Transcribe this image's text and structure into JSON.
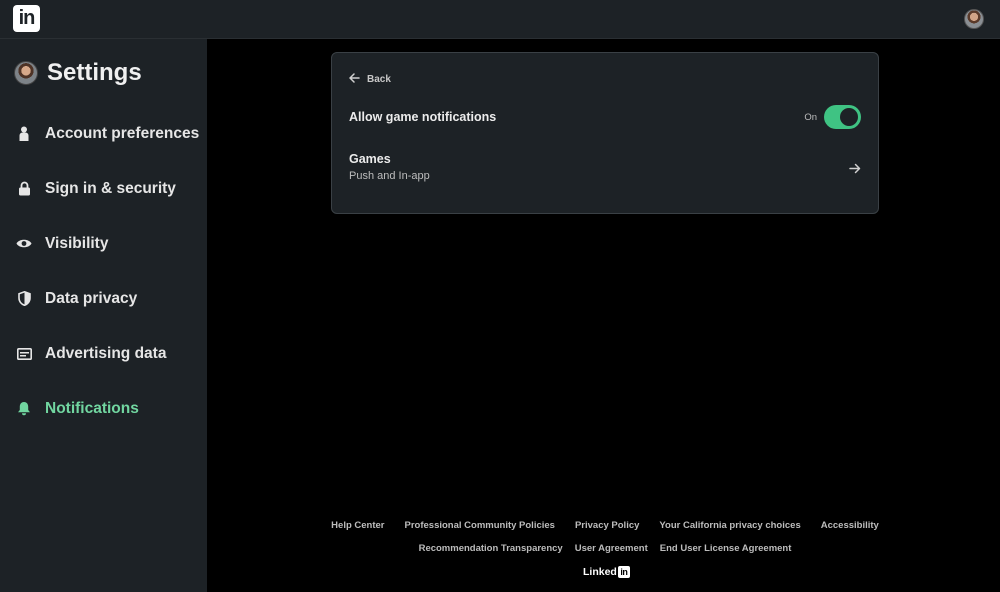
{
  "topbar": {
    "logo_text": "in"
  },
  "sidebar": {
    "title": "Settings",
    "items": [
      {
        "label": "Account preferences",
        "icon": "person-icon",
        "active": false
      },
      {
        "label": "Sign in & security",
        "icon": "lock-icon",
        "active": false
      },
      {
        "label": "Visibility",
        "icon": "eye-icon",
        "active": false
      },
      {
        "label": "Data privacy",
        "icon": "shield-icon",
        "active": false
      },
      {
        "label": "Advertising data",
        "icon": "ad-card-icon",
        "active": false
      },
      {
        "label": "Notifications",
        "icon": "bell-icon",
        "active": true
      }
    ]
  },
  "main": {
    "back_label": "Back",
    "allow_label": "Allow game notifications",
    "toggle_state": "On",
    "toggle_on": true,
    "games": {
      "title": "Games",
      "subtitle": "Push and In-app"
    }
  },
  "footer": {
    "links_row1": [
      "Help Center",
      "Professional Community Policies",
      "Privacy Policy",
      "Your California privacy choices",
      "Accessibility"
    ],
    "links_row2": [
      "Recommendation Transparency",
      "User Agreement",
      "End User License Agreement"
    ],
    "brand_text": "Linked",
    "brand_in": "in"
  },
  "colors": {
    "accent_green": "#71d6a0",
    "toggle_green": "#3fc383",
    "panel": "#1d2226",
    "background": "#000000"
  }
}
